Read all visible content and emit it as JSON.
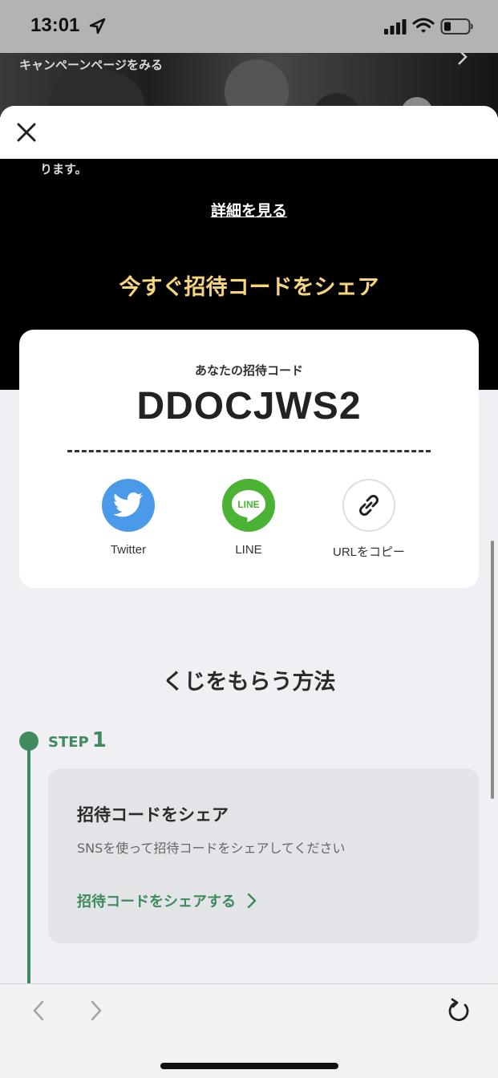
{
  "status_bar": {
    "time": "13:01",
    "location_icon": "location-arrow-icon",
    "signal_icon": "cellular-signal-icon",
    "wifi_icon": "wifi-icon",
    "battery_icon": "battery-low-icon"
  },
  "behind_page": {
    "campaign_link": "キャンペーンページをみる"
  },
  "sheet": {
    "close_icon": "close-icon",
    "hero": {
      "snippet": "ります。",
      "details_link": "詳細を見る",
      "title": "今すぐ招待コードをシェア",
      "title_color": "#f6d57c"
    },
    "code_card": {
      "label": "あなたの招待コード",
      "code": "DDOCJWS2",
      "share": [
        {
          "icon": "twitter-bird-icon",
          "label": "Twitter",
          "color": "#4a9ae9"
        },
        {
          "icon": "line-icon",
          "label": "LINE",
          "icon_text": "LINE",
          "color": "#4cb234"
        },
        {
          "icon": "link-icon",
          "label": "URLをコピー"
        }
      ]
    },
    "howto": {
      "title": "くじをもらう方法",
      "step": {
        "word": "STEP",
        "number": "1",
        "card_title": "招待コードをシェア",
        "card_desc": "SNSを使って招待コードをシェアしてください",
        "action_label": "招待コードをシェアする",
        "accent_color": "#3f8a5e"
      }
    }
  },
  "toolbar": {
    "back_icon": "chevron-left-icon",
    "forward_icon": "chevron-right-icon",
    "reload_icon": "reload-icon"
  }
}
